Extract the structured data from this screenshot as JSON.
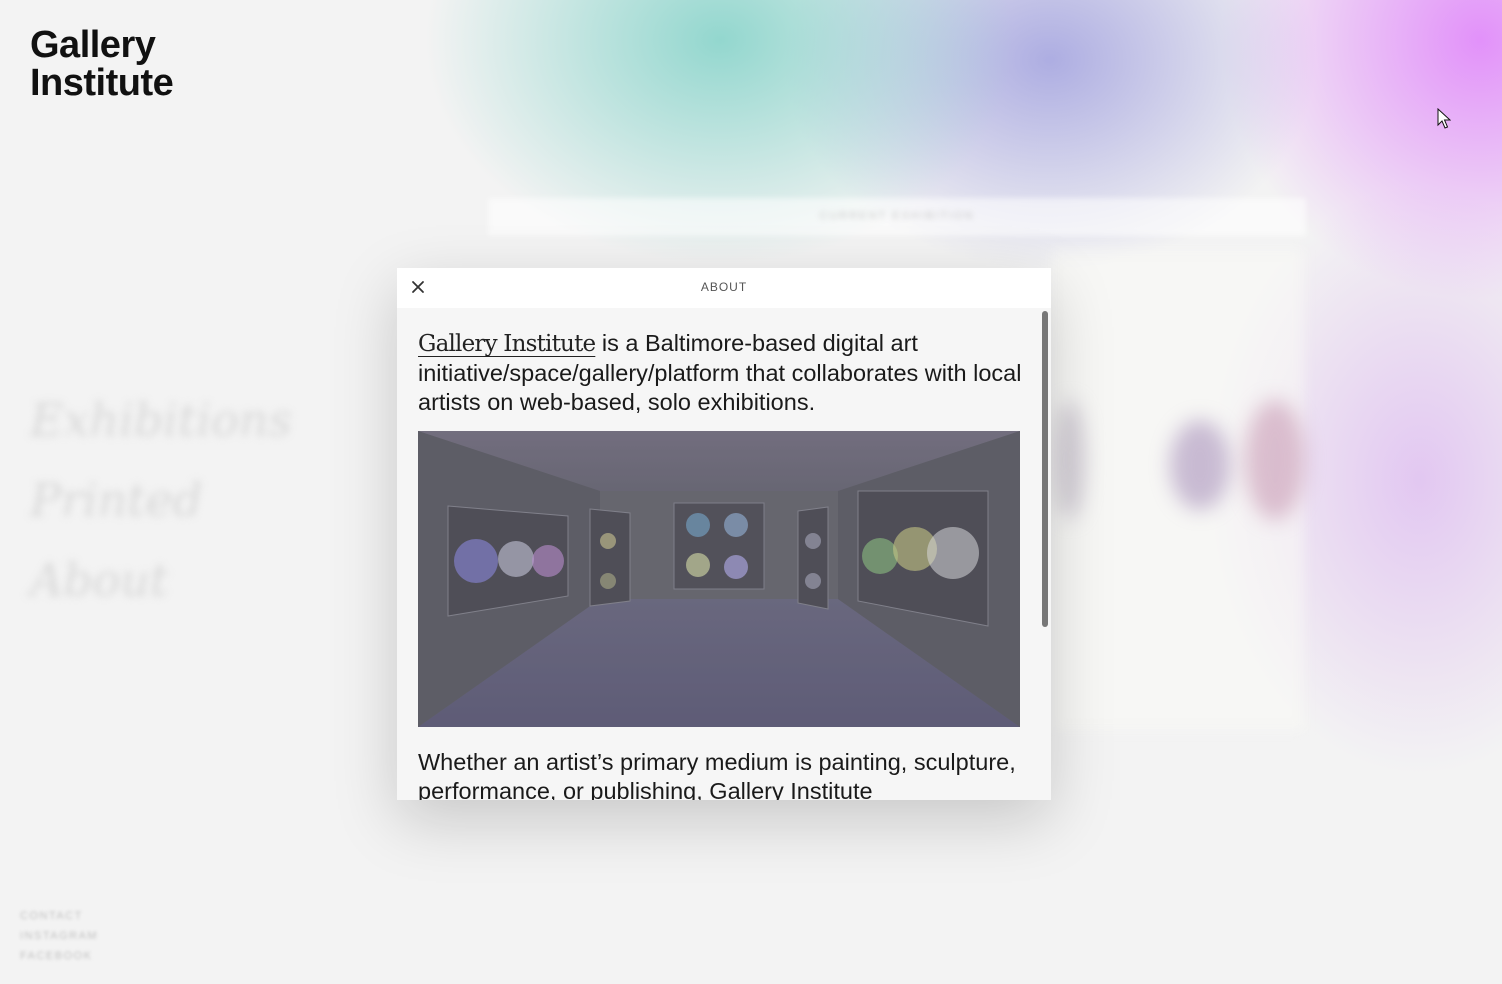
{
  "site": {
    "logo_line1": "Gallery",
    "logo_line2": "Institute"
  },
  "background_nav": {
    "items": [
      "Exhibitions",
      "Printed",
      "About"
    ]
  },
  "background_footer": {
    "links": [
      "CONTACT",
      "INSTAGRAM",
      "FACEBOOK"
    ]
  },
  "background_bar": {
    "label": "CURRENT EXHIBITION"
  },
  "modal": {
    "title": "ABOUT",
    "close_icon": "close-icon",
    "intro_link": "Gallery Institute",
    "intro_rest": " is a Baltimore-based digital art initiative/space/gallery/platform that collaborates with local artists on web-based, solo exhibitions.",
    "image_alt": "gallery-room-image",
    "paragraph2": "Whether an artist’s primary medium is painting, sculpture, performance, or publishing, Gallery Institute"
  },
  "colors": {
    "accent_teal": "#82d2c8",
    "accent_violet": "#e18cfa",
    "text": "#1a1a1a"
  }
}
